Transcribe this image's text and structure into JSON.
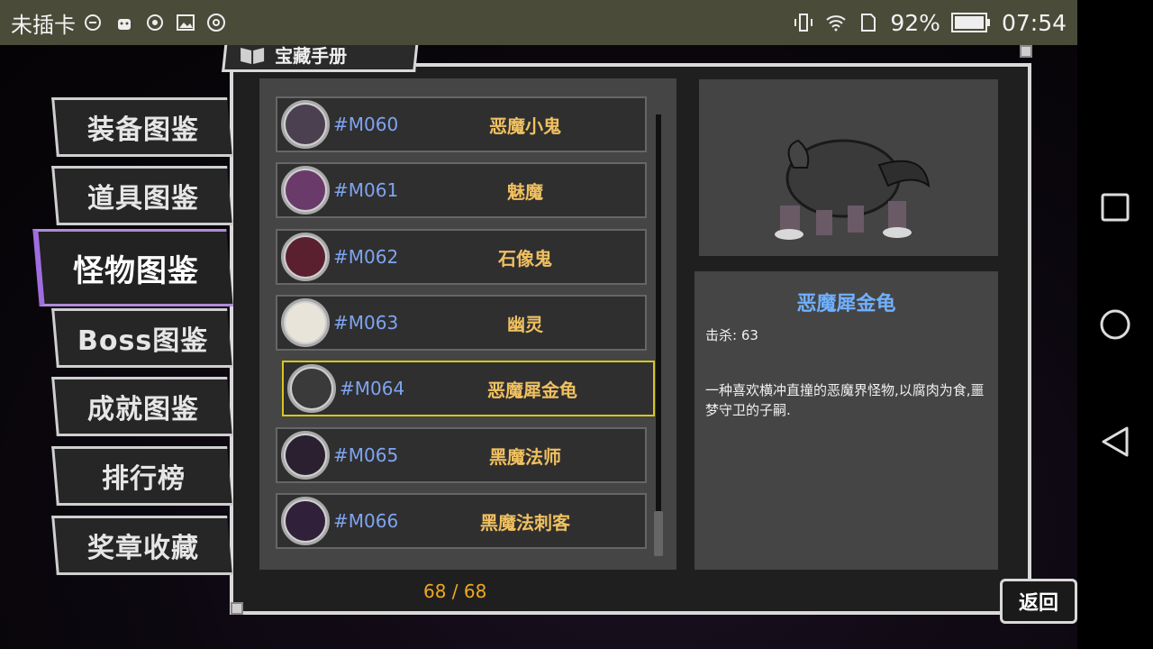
{
  "status_bar": {
    "carrier": "未插卡",
    "battery_pct": "92%",
    "clock": "07:54"
  },
  "panel_title": "宝藏手册",
  "tabs": [
    {
      "label": "装备图鉴"
    },
    {
      "label": "道具图鉴"
    },
    {
      "label": "怪物图鉴"
    },
    {
      "label": "Boss图鉴"
    },
    {
      "label": "成就图鉴"
    },
    {
      "label": "排行榜"
    },
    {
      "label": "奖章收藏"
    }
  ],
  "active_tab": "怪物图鉴",
  "monsters": [
    {
      "code": "#M060",
      "name": "恶魔小鬼"
    },
    {
      "code": "#M061",
      "name": "魅魔"
    },
    {
      "code": "#M062",
      "name": "石像鬼"
    },
    {
      "code": "#M063",
      "name": "幽灵"
    },
    {
      "code": "#M064",
      "name": "恶魔犀金龟"
    },
    {
      "code": "#M065",
      "name": "黑魔法师"
    },
    {
      "code": "#M066",
      "name": "黑魔法刺客"
    }
  ],
  "selected_index": 4,
  "pager": "68 / 68",
  "detail": {
    "name": "恶魔犀金龟",
    "kills": "击杀: 63",
    "description": "一种喜欢横冲直撞的恶魔界怪物,以腐肉为食,噩梦守卫的子嗣."
  },
  "back_label": "返回",
  "colors": {
    "accent_purple": "#9f6de0",
    "code_blue": "#7fa4f0",
    "name_gold": "#f0c060",
    "selected_border": "#d6c71e",
    "pager_orange": "#f0a820"
  }
}
